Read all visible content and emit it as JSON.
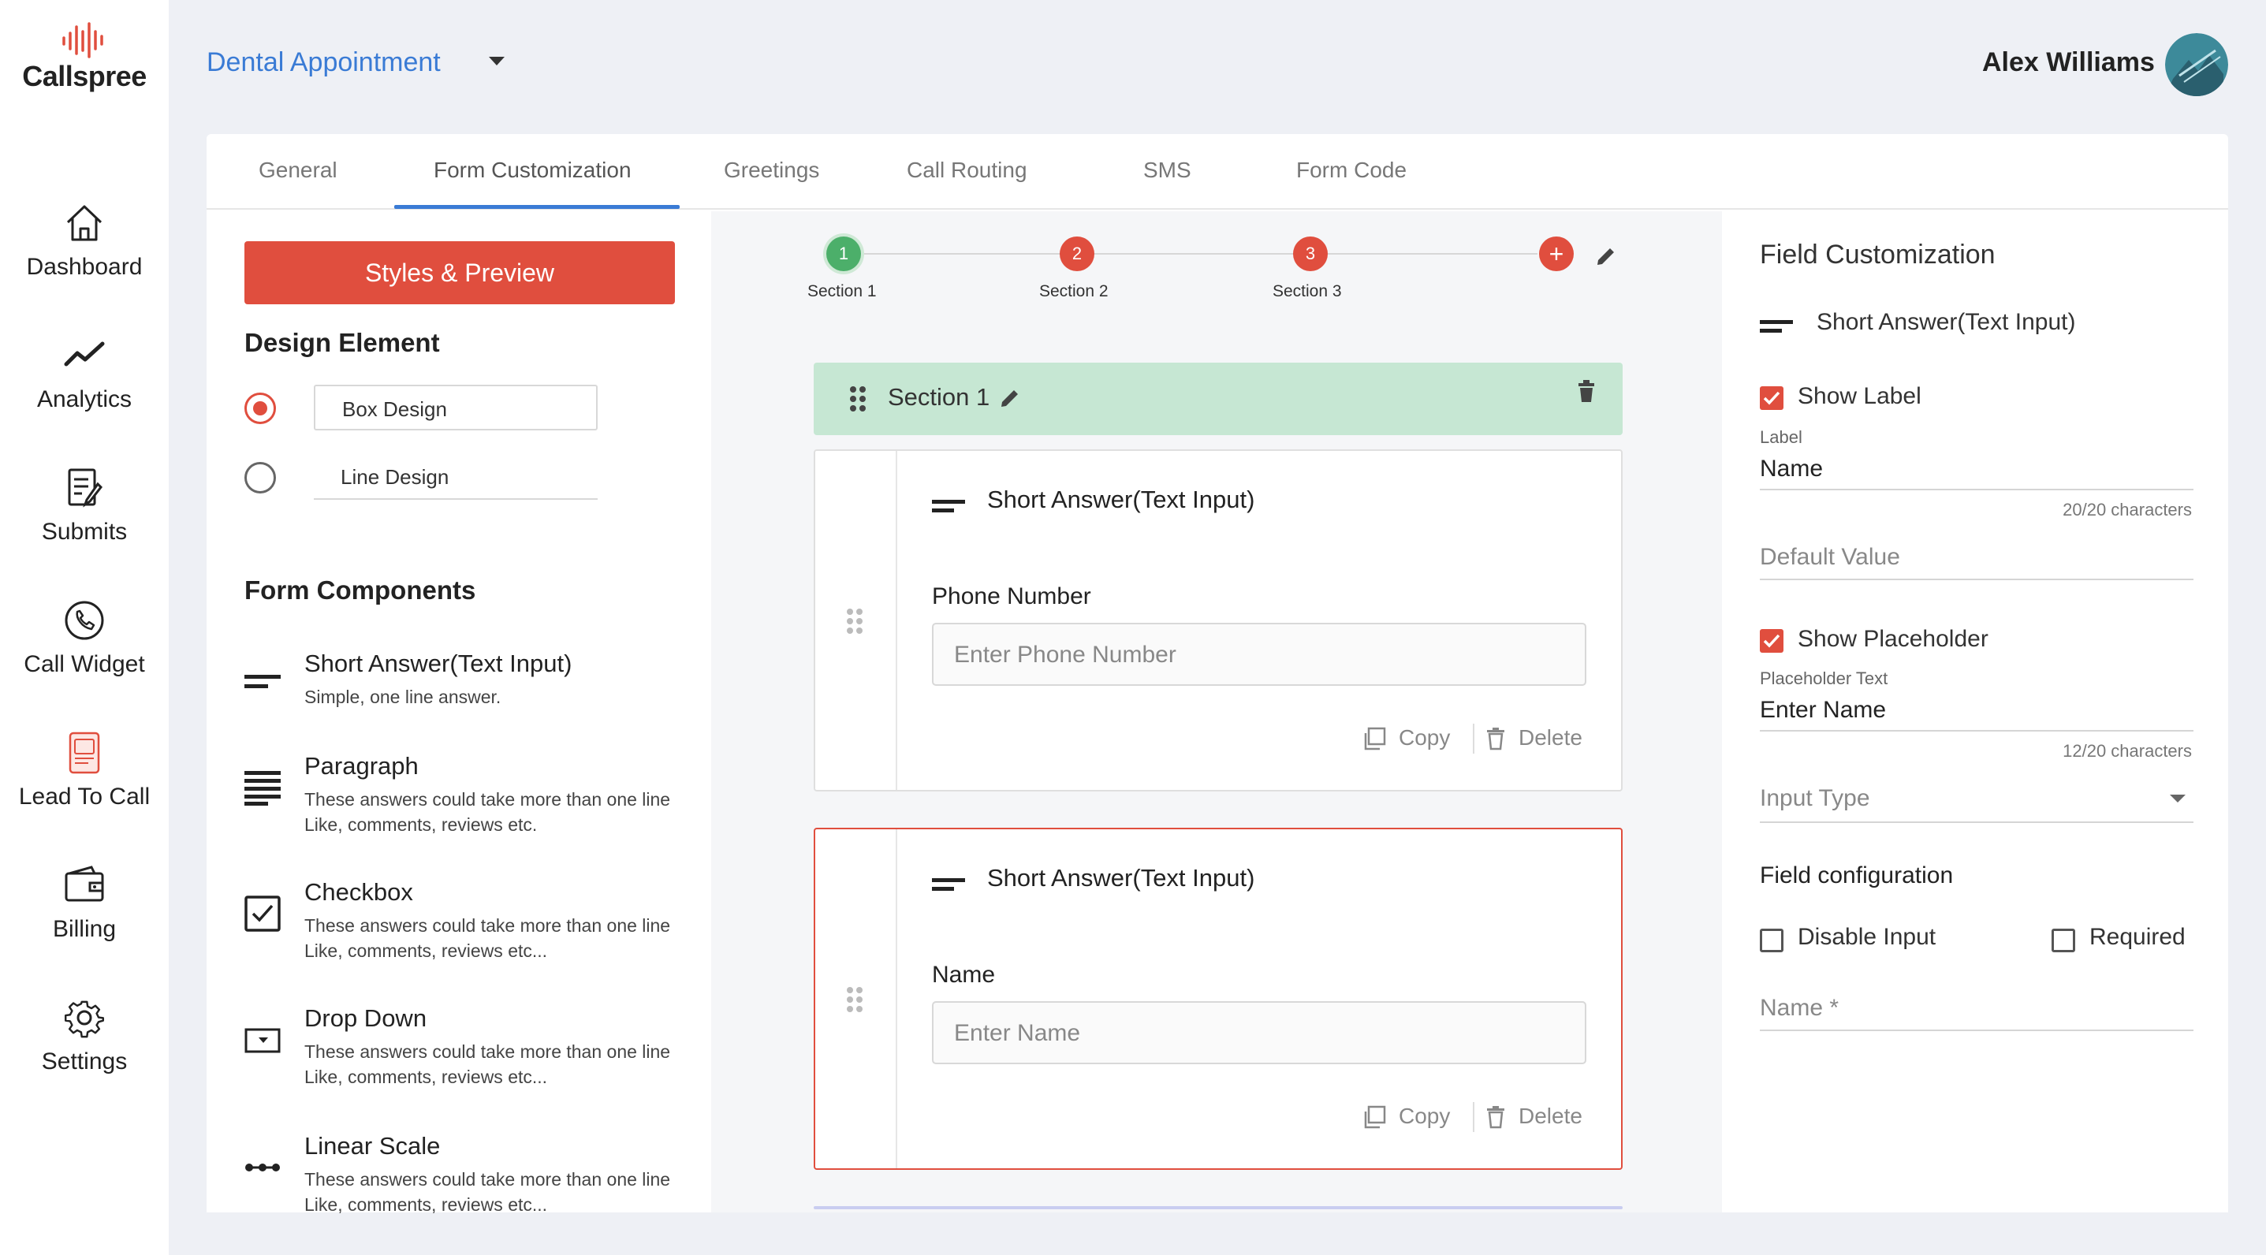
{
  "app": {
    "brand": "Callspree",
    "form_title": "Dental Appointment",
    "user_name": "Alex Williams",
    "brand_color": "#e04e3e",
    "accent_color": "#3a7bd5"
  },
  "sidebar": {
    "items": [
      {
        "label": "Dashboard",
        "icon": "home-icon"
      },
      {
        "label": "Analytics",
        "icon": "analytics-icon"
      },
      {
        "label": "Submits",
        "icon": "submits-icon"
      },
      {
        "label": "Call Widget",
        "icon": "phone-icon"
      },
      {
        "label": "Lead To Call",
        "icon": "lead-to-call-icon"
      },
      {
        "label": "Billing",
        "icon": "wallet-icon"
      },
      {
        "label": "Settings",
        "icon": "gear-icon"
      }
    ]
  },
  "tabs": [
    "General",
    "Form Customization",
    "Greetings",
    "Call Routing",
    "SMS",
    "Form Code"
  ],
  "active_tab": "Form Customization",
  "left": {
    "styles_button": "Styles & Preview",
    "design_heading": "Design Element",
    "design_options": [
      "Box Design",
      "Line Design"
    ],
    "selected_design": "Box Design",
    "components_heading": "Form Components",
    "components": [
      {
        "title": "Short Answer(Text Input)",
        "desc": "Simple, one line answer."
      },
      {
        "title": "Paragraph",
        "desc": "These answers could take more than one line Like, comments, reviews etc."
      },
      {
        "title": "Checkbox",
        "desc": "These answers could take more than one line Like, comments, reviews etc..."
      },
      {
        "title": "Drop Down",
        "desc": "These answers could take more than one line Like, comments, reviews etc..."
      },
      {
        "title": "Linear Scale",
        "desc": "These answers could take more than one line Like, comments, reviews etc..."
      }
    ]
  },
  "center": {
    "steps": [
      {
        "num": "1",
        "label": "Section 1",
        "color": "#4caf6a"
      },
      {
        "num": "2",
        "label": "Section 2",
        "color": "#e04e3e"
      },
      {
        "num": "3",
        "label": "Section 3",
        "color": "#e04e3e"
      }
    ],
    "add_step": "+",
    "section_title": "Section 1",
    "fields": [
      {
        "type": "Short Answer(Text Input)",
        "label": "Phone Number",
        "placeholder": "Enter Phone Number",
        "copy": "Copy",
        "delete": "Delete"
      },
      {
        "type": "Short Answer(Text Input)",
        "label": "Name",
        "placeholder": "Enter Name",
        "copy": "Copy",
        "delete": "Delete"
      }
    ]
  },
  "right": {
    "title": "Field Customization",
    "field_type": "Short Answer(Text Input)",
    "show_label": "Show Label",
    "label_caption": "Label",
    "label_value": "Name",
    "label_count": "20/20 characters",
    "default_value_placeholder": "Default Value",
    "show_placeholder": "Show Placeholder",
    "placeholder_caption": "Placeholder Text",
    "placeholder_value": "Enter Name",
    "placeholder_count": "12/20 characters",
    "input_type": "Input Type",
    "field_config": "Field configuration",
    "disable_input": "Disable Input",
    "required": "Required",
    "name_field": "Name *"
  }
}
